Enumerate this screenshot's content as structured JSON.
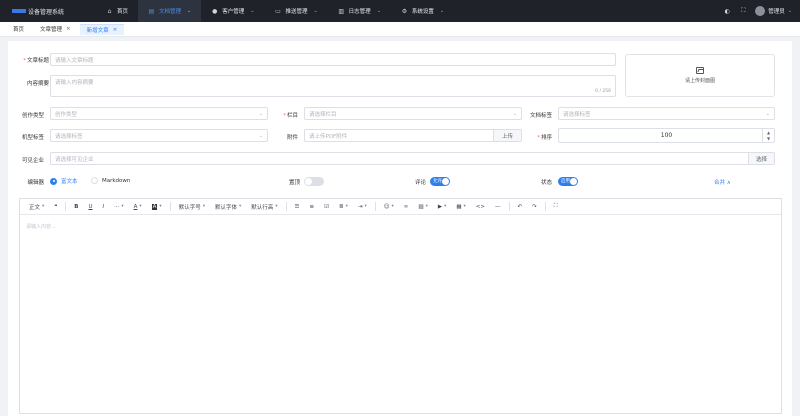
{
  "app": {
    "title": "设备管理系统"
  },
  "nav": [
    {
      "label": "首页",
      "icon": "home-icon",
      "glyph": "⌂",
      "chevron": false,
      "active": false
    },
    {
      "label": "文档管理",
      "icon": "document-icon",
      "glyph": "▤",
      "chevron": true,
      "active": true
    },
    {
      "label": "客户管理",
      "icon": "user-icon",
      "glyph": "●",
      "chevron": true,
      "active": false
    },
    {
      "label": "推送管理",
      "icon": "message-icon",
      "glyph": "▭",
      "chevron": true,
      "active": false
    },
    {
      "label": "日志管理",
      "icon": "log-icon",
      "glyph": "▥",
      "chevron": true,
      "active": false
    },
    {
      "label": "系统设置",
      "icon": "gear-icon",
      "glyph": "⚙",
      "chevron": true,
      "active": false
    }
  ],
  "user": {
    "name": "管理员"
  },
  "tabs": [
    {
      "label": "首页",
      "closable": false,
      "active": false
    },
    {
      "label": "文章管理",
      "closable": true,
      "active": false
    },
    {
      "label": "新增文章",
      "closable": true,
      "active": true
    }
  ],
  "form": {
    "title": {
      "label": "文章标题",
      "placeholder": "请输入文章标题"
    },
    "summary": {
      "label": "内容摘要",
      "placeholder": "请输入内容摘要",
      "counter": "0 / 256"
    },
    "cover": {
      "label": "请上传封面图"
    },
    "creation_type": {
      "label": "创作类型",
      "placeholder": "创作类型"
    },
    "column": {
      "label": "栏目",
      "placeholder": "请选择栏目"
    },
    "doc_tag": {
      "label": "文档标签",
      "placeholder": "请选择标签"
    },
    "model_tag": {
      "label": "机型标签",
      "placeholder": "请选择标签"
    },
    "attachment": {
      "label": "附件",
      "placeholder": "请上传PDF附件",
      "button": "上传"
    },
    "sort": {
      "label": "排序",
      "value": "100"
    },
    "visible_company": {
      "label": "可见企业",
      "placeholder": "请选择可见企业",
      "button": "选择"
    },
    "editor_type": {
      "label": "编辑器",
      "options": [
        "富文本",
        "Markdown"
      ],
      "selected": "富文本"
    },
    "top": {
      "label": "置顶"
    },
    "comment": {
      "label": "评论",
      "switch_text": "允许"
    },
    "status": {
      "label": "状态",
      "switch_text": "启用"
    },
    "collapse": {
      "label": "合并 ∧"
    }
  },
  "editor": {
    "toolbar": {
      "paragraph": "正文",
      "quote": "❝",
      "bold": "B",
      "underline": "U",
      "italic": "I",
      "more": "···",
      "font_color": "A",
      "bg_color": "A",
      "font_size": "默认字号",
      "font_family": "默认字体",
      "line_height": "默认行高",
      "bullet_list": "☰",
      "number_list": "≡",
      "todo": "☑",
      "align": "≣",
      "indent": "⇥",
      "emoji": "☺",
      "link": "🔗",
      "image": "▨",
      "video": "▶",
      "table": "▦",
      "code": "<>",
      "divider": "—",
      "undo": "↶",
      "redo": "↷",
      "fullscreen": "⛶"
    },
    "placeholder": "请输入内容..."
  },
  "colors": {
    "accent": "#2f80ed",
    "nav_bg": "#1f2229",
    "danger": "#f56c6c"
  }
}
